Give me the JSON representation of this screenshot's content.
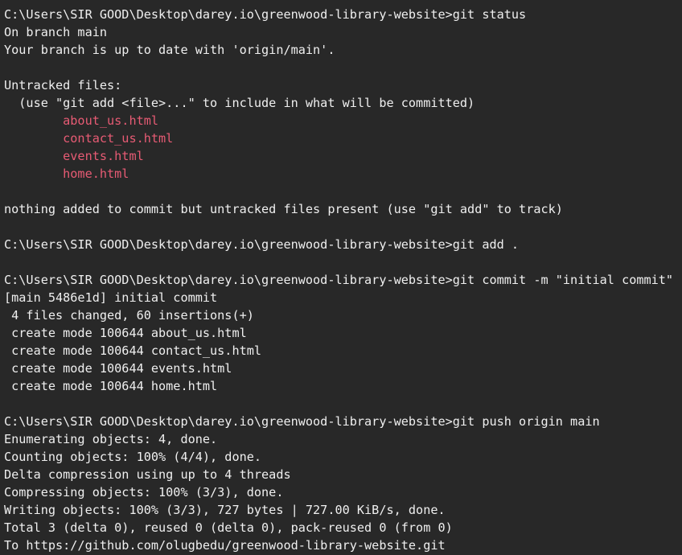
{
  "colors": {
    "background": "#282828",
    "text": "#efefef",
    "untracked": "#e75b74"
  },
  "lines": [
    {
      "text": "C:\\Users\\SIR GOOD\\Desktop\\darey.io\\greenwood-library-website>git status",
      "kind": "prompt"
    },
    {
      "text": "On branch main",
      "kind": "output"
    },
    {
      "text": "Your branch is up to date with 'origin/main'.",
      "kind": "output"
    },
    {
      "text": "",
      "kind": "blank"
    },
    {
      "text": "Untracked files:",
      "kind": "output"
    },
    {
      "text": "  (use \"git add <file>...\" to include in what will be committed)",
      "kind": "output"
    },
    {
      "text": "        about_us.html",
      "kind": "untracked"
    },
    {
      "text": "        contact_us.html",
      "kind": "untracked"
    },
    {
      "text": "        events.html",
      "kind": "untracked"
    },
    {
      "text": "        home.html",
      "kind": "untracked"
    },
    {
      "text": "",
      "kind": "blank"
    },
    {
      "text": "nothing added to commit but untracked files present (use \"git add\" to track)",
      "kind": "output"
    },
    {
      "text": "",
      "kind": "blank"
    },
    {
      "text": "C:\\Users\\SIR GOOD\\Desktop\\darey.io\\greenwood-library-website>git add .",
      "kind": "prompt"
    },
    {
      "text": "",
      "kind": "blank"
    },
    {
      "text": "C:\\Users\\SIR GOOD\\Desktop\\darey.io\\greenwood-library-website>git commit -m \"initial commit\"",
      "kind": "prompt"
    },
    {
      "text": "[main 5486e1d] initial commit",
      "kind": "output"
    },
    {
      "text": " 4 files changed, 60 insertions(+)",
      "kind": "output"
    },
    {
      "text": " create mode 100644 about_us.html",
      "kind": "output"
    },
    {
      "text": " create mode 100644 contact_us.html",
      "kind": "output"
    },
    {
      "text": " create mode 100644 events.html",
      "kind": "output"
    },
    {
      "text": " create mode 100644 home.html",
      "kind": "output"
    },
    {
      "text": "",
      "kind": "blank"
    },
    {
      "text": "C:\\Users\\SIR GOOD\\Desktop\\darey.io\\greenwood-library-website>git push origin main",
      "kind": "prompt"
    },
    {
      "text": "Enumerating objects: 4, done.",
      "kind": "output"
    },
    {
      "text": "Counting objects: 100% (4/4), done.",
      "kind": "output"
    },
    {
      "text": "Delta compression using up to 4 threads",
      "kind": "output"
    },
    {
      "text": "Compressing objects: 100% (3/3), done.",
      "kind": "output"
    },
    {
      "text": "Writing objects: 100% (3/3), 727 bytes | 727.00 KiB/s, done.",
      "kind": "output"
    },
    {
      "text": "Total 3 (delta 0), reused 0 (delta 0), pack-reused 0 (from 0)",
      "kind": "output"
    },
    {
      "text": "To https://github.com/olugbedu/greenwood-library-website.git",
      "kind": "output"
    }
  ]
}
